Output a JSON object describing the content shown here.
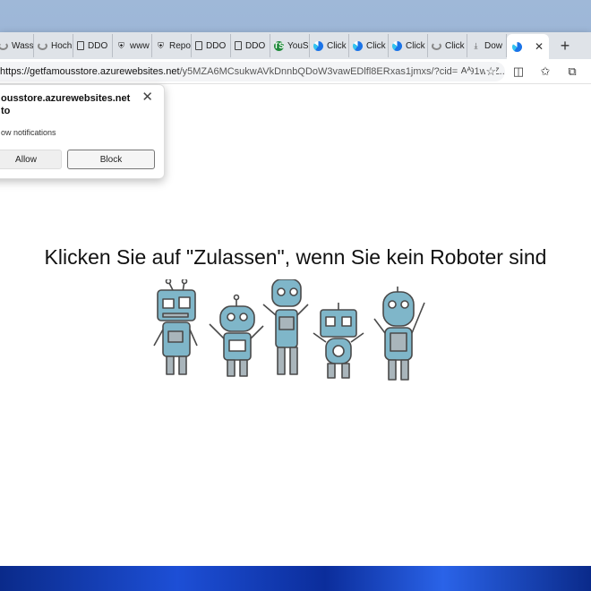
{
  "tabs": [
    {
      "label": "Wass",
      "icon": "loading-icon"
    },
    {
      "label": "Hoch",
      "icon": "loading-icon"
    },
    {
      "label": "DDO",
      "icon": "page-icon"
    },
    {
      "label": "www",
      "icon": "shield-page-icon"
    },
    {
      "label": "Repo",
      "icon": "shield-page-icon"
    },
    {
      "label": "DDO",
      "icon": "page-icon"
    },
    {
      "label": "DDO",
      "icon": "page-icon"
    },
    {
      "label": "YouS",
      "icon": "ts-icon"
    },
    {
      "label": "Click",
      "icon": "edge-icon"
    },
    {
      "label": "Click",
      "icon": "edge-icon"
    },
    {
      "label": "Click",
      "icon": "edge-icon"
    },
    {
      "label": "Click",
      "icon": "loading-icon"
    },
    {
      "label": "Dow",
      "icon": "download-icon"
    }
  ],
  "active_tab": {
    "close": "✕"
  },
  "new_tab": "+",
  "address": {
    "host": "https://getfamousstore.azurewebsites.net",
    "path": "/y5MZA6MCsukwAVkDnnbQDoW3vawEDlfl8ERxas1jmxs/?cid=8091wKZ...",
    "reader": "Aᴬ"
  },
  "popup": {
    "site": "ousstore.azurewebsites.net",
    "site_line2": "to",
    "permission": "ow notifications",
    "allow": "Allow",
    "block": "Block",
    "close": "✕"
  },
  "page": {
    "headline": "Klicken Sie auf \"Zulassen\", wenn Sie kein Roboter sind"
  },
  "colors": {
    "robot_body": "#7fb6c9",
    "robot_outline": "#4a4a4a",
    "robot_legs": "#a9b5bb"
  }
}
